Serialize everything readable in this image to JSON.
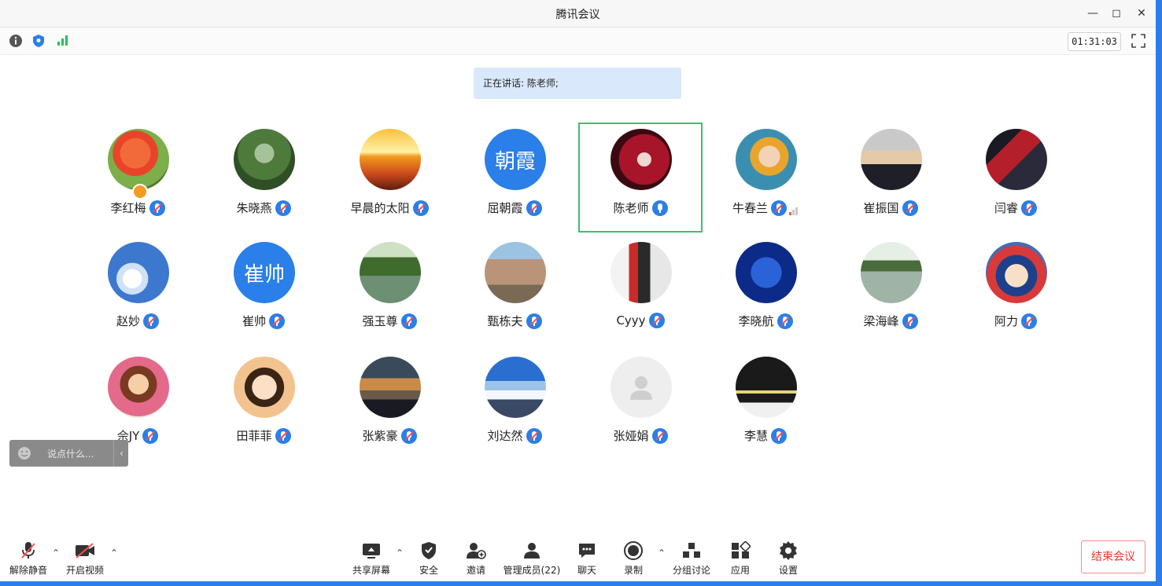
{
  "window": {
    "title": "腾讯会议"
  },
  "infobar": {
    "timer": "01:31:03"
  },
  "speaking": "正在讲话: 陈老师;",
  "participants": [
    {
      "name": "李红梅",
      "avatar": "photo-lily"
    },
    {
      "name": "朱晓燕",
      "avatar": "photo-plants"
    },
    {
      "name": "早晨的太阳",
      "avatar": "photo-sunrise"
    },
    {
      "name": "屈朝霞",
      "avatar_text": "朝霞"
    },
    {
      "name": "陈老师",
      "avatar": "photo-redhair",
      "speaking": true
    },
    {
      "name": "牛春兰",
      "avatar": "photo-person"
    },
    {
      "name": "崔振国",
      "avatar": "photo-suit"
    },
    {
      "name": "闫睿",
      "avatar": "photo-basketball"
    },
    {
      "name": "赵妙",
      "avatar": "photo-sky"
    },
    {
      "name": "崔帅",
      "avatar_text": "崔帅"
    },
    {
      "name": "强玉尊",
      "avatar": "photo-lake"
    },
    {
      "name": "甄栋夫",
      "avatar": "photo-town"
    },
    {
      "name": "Cyyy",
      "avatar": "photo-shop"
    },
    {
      "name": "李晓航",
      "avatar": "photo-stars"
    },
    {
      "name": "梁海峰",
      "avatar": "photo-reflection"
    },
    {
      "name": "阿力",
      "avatar": "photo-cartoon"
    },
    {
      "name": "佘JY",
      "avatar": "photo-cartoon-girl"
    },
    {
      "name": "田菲菲",
      "avatar": "photo-cartoon-princess"
    },
    {
      "name": "张紫豪",
      "avatar": "photo-sunset"
    },
    {
      "name": "刘达然",
      "avatar": "photo-mountain"
    },
    {
      "name": "张娅娟",
      "avatar": "default-user"
    },
    {
      "name": "李慧",
      "avatar": "photo-blackboard"
    }
  ],
  "chat": {
    "placeholder": "说点什么..."
  },
  "toolbar": {
    "unmute": "解除静音",
    "video": "开启视频",
    "share": "共享屏幕",
    "security": "安全",
    "invite": "邀请",
    "members": "管理成员(22)",
    "chat": "聊天",
    "record": "录制",
    "breakout": "分组讨论",
    "apps": "应用",
    "settings": "设置"
  },
  "end_button": "结束会议",
  "colors": {
    "accent": "#2a7fe8",
    "speaking_border": "#3cbf6f",
    "end": "#e53935"
  }
}
